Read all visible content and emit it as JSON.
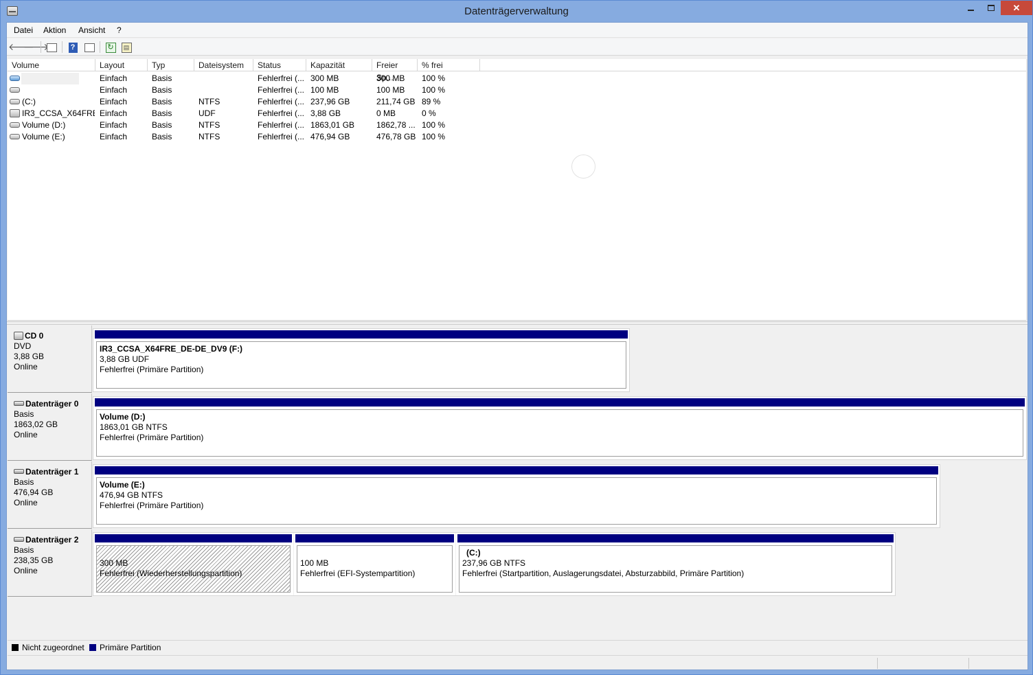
{
  "window": {
    "title": "Datenträgerverwaltung"
  },
  "menu": [
    "Datei",
    "Aktion",
    "Ansicht",
    "?"
  ],
  "volumes": {
    "headers": [
      "Volume",
      "Layout",
      "Typ",
      "Dateisystem",
      "Status",
      "Kapazität",
      "Freier Sp...",
      "% frei"
    ],
    "rows": [
      {
        "name": "",
        "icon": "blue-disk-icon",
        "layout": "Einfach",
        "typ": "Basis",
        "fs": "",
        "status": "Fehlerfrei (...",
        "cap": "300 MB",
        "free": "300 MB",
        "pct": "100 %"
      },
      {
        "name": "",
        "icon": "disk-icon",
        "layout": "Einfach",
        "typ": "Basis",
        "fs": "",
        "status": "Fehlerfrei (...",
        "cap": "100 MB",
        "free": "100 MB",
        "pct": "100 %"
      },
      {
        "name": "(C:)",
        "icon": "disk-icon",
        "layout": "Einfach",
        "typ": "Basis",
        "fs": "NTFS",
        "status": "Fehlerfrei (...",
        "cap": "237,96 GB",
        "free": "211,74 GB",
        "pct": "89 %"
      },
      {
        "name": "IR3_CCSA_X64FRE...",
        "icon": "cd-icon",
        "layout": "Einfach",
        "typ": "Basis",
        "fs": "UDF",
        "status": "Fehlerfrei (...",
        "cap": "3,88 GB",
        "free": "0 MB",
        "pct": "0 %"
      },
      {
        "name": "Volume (D:)",
        "icon": "disk-icon",
        "layout": "Einfach",
        "typ": "Basis",
        "fs": "NTFS",
        "status": "Fehlerfrei (...",
        "cap": "1863,01 GB",
        "free": "1862,78 ...",
        "pct": "100 %"
      },
      {
        "name": "Volume (E:)",
        "icon": "disk-icon",
        "layout": "Einfach",
        "typ": "Basis",
        "fs": "NTFS",
        "status": "Fehlerfrei (...",
        "cap": "476,94 GB",
        "free": "476,78 GB",
        "pct": "100 %"
      }
    ]
  },
  "disks": [
    {
      "name": "CD 0",
      "kind": "DVD",
      "size": "3,88 GB",
      "state": "Online",
      "icon": "cd-drive-icon",
      "partitions": [
        {
          "title": "IR3_CCSA_X64FRE_DE-DE_DV9  (F:)",
          "line1": "3,88 GB UDF",
          "line2": "Fehlerfrei (Primäre Partition)",
          "hatched": false
        }
      ]
    },
    {
      "name": "Datenträger 0",
      "kind": "Basis",
      "size": "1863,02 GB",
      "state": "Online",
      "icon": "disk-drive-icon",
      "partitions": [
        {
          "title": "Volume  (D:)",
          "line1": "1863,01 GB NTFS",
          "line2": "Fehlerfrei (Primäre Partition)",
          "hatched": false
        }
      ]
    },
    {
      "name": "Datenträger 1",
      "kind": "Basis",
      "size": "476,94 GB",
      "state": "Online",
      "icon": "disk-drive-icon",
      "partitions": [
        {
          "title": "Volume  (E:)",
          "line1": "476,94 GB NTFS",
          "line2": "Fehlerfrei (Primäre Partition)",
          "hatched": false
        }
      ]
    },
    {
      "name": "Datenträger 2",
      "kind": "Basis",
      "size": "238,35 GB",
      "state": "Online",
      "icon": "disk-drive-icon",
      "partitions": [
        {
          "title": "",
          "line1": "300 MB",
          "line2": "Fehlerfrei (Wiederherstellungspartition)",
          "hatched": true
        },
        {
          "title": "",
          "line1": "100 MB",
          "line2": "Fehlerfrei (EFI-Systempartition)",
          "hatched": false
        },
        {
          "title": "(C:)",
          "line1": "237,96 GB NTFS",
          "line2": "Fehlerfrei (Startpartition, Auslagerungsdatei, Absturzabbild, Primäre Partition)",
          "hatched": false
        }
      ]
    }
  ],
  "legend": [
    {
      "label": "Nicht zugeordnet",
      "color": "#000000"
    },
    {
      "label": "Primäre Partition",
      "color": "#000080"
    }
  ],
  "colors": {
    "titlebar": "#86abe0",
    "partition_bar": "#000080",
    "close_button": "#c7493a"
  }
}
